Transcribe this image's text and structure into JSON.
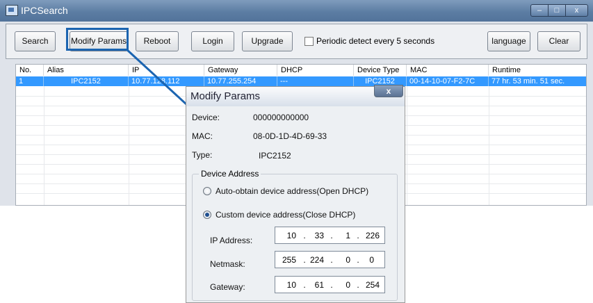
{
  "window": {
    "title": "IPCSearch",
    "controls": {
      "minimize": "–",
      "maximize": "□",
      "close": "x"
    }
  },
  "toolbar": {
    "search": "Search",
    "modify_params": "Modify Params",
    "reboot": "Reboot",
    "login": "Login",
    "upgrade": "Upgrade",
    "periodic_label": "Periodic detect every 5 seconds",
    "periodic_checked": false,
    "language": "language",
    "clear": "Clear"
  },
  "table": {
    "columns": [
      "No.",
      "Alias",
      "IP",
      "Gateway",
      "DHCP",
      "Device Type",
      "MAC",
      "Runtime"
    ],
    "selected_row": [
      "1",
      "IPC2152",
      "10.77.128.112",
      "10.77.255.254",
      "---",
      "IPC2152",
      "00-14-10-07-F2-7C",
      "77 hr. 53 min. 51 sec."
    ]
  },
  "dialog": {
    "title": "Modify Params",
    "close": "x",
    "device_label": "Device:",
    "device_value": "000000000000",
    "mac_label": "MAC:",
    "mac_value": "08-0D-1D-4D-69-33",
    "type_label": "Type:",
    "type_value": "IPC2152",
    "group_title": "Device Address",
    "radio_auto": "Auto-obtain device address(Open DHCP)",
    "radio_custom": "Custom device address(Close DHCP)",
    "selected_option": "custom",
    "ip_label": "IP Address:",
    "ip": [
      "10",
      "33",
      "1",
      "226"
    ],
    "netmask_label": "Netmask:",
    "netmask": [
      "255",
      "224",
      "0",
      "0"
    ],
    "gateway_label": "Gateway:",
    "gateway": [
      "10",
      "61",
      "0",
      "254"
    ]
  },
  "colors": {
    "selection": "#3399ff",
    "highlight_callout": "#1b64b0"
  }
}
